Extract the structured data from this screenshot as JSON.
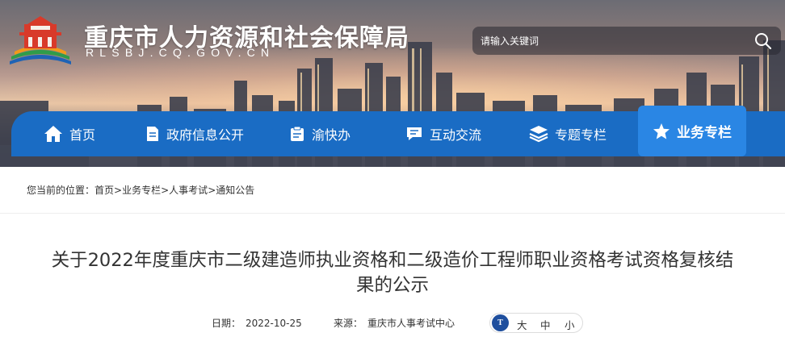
{
  "header": {
    "site_title": "重庆市人力资源和社会保障局",
    "site_domain": "RLSBJ.CQ.GOV.CN",
    "logo_icon": "government-building-logo-icon"
  },
  "search": {
    "placeholder": "请输入关键词",
    "icon": "search-icon"
  },
  "nav": {
    "items": [
      {
        "label": "首页",
        "icon": "home-icon"
      },
      {
        "label": "政府信息公开",
        "icon": "document-icon"
      },
      {
        "label": "渝快办",
        "icon": "clipboard-icon"
      },
      {
        "label": "互动交流",
        "icon": "chat-icon"
      },
      {
        "label": "专题专栏",
        "icon": "layers-icon"
      },
      {
        "label": "业务专栏",
        "icon": "star-icon",
        "active": true
      }
    ]
  },
  "breadcrumb": {
    "prefix": "您当前的位置：",
    "items": [
      "首页",
      "业务专栏",
      "人事考试",
      "通知公告"
    ],
    "separator": ">"
  },
  "article": {
    "title_line1": "关于2022年度重庆市二级建造师执业资格和二级造价工程师职业资格考试资格复核结",
    "title_line2": "果的公示",
    "date_label": "日期：",
    "date": "2022-10-25",
    "source_label": "来源：",
    "source": "重庆市人事考试中心"
  },
  "font_size_control": {
    "icon_label": "T",
    "options": [
      "大",
      "中",
      "小"
    ]
  },
  "colors": {
    "nav_bg": "#1a6cc4",
    "nav_active_bg": "#2a86e4",
    "logo_red": "#d83a2a",
    "logo_orange": "#f29a1a",
    "logo_green": "#2f9c4a",
    "logo_blue": "#1e63b5"
  }
}
